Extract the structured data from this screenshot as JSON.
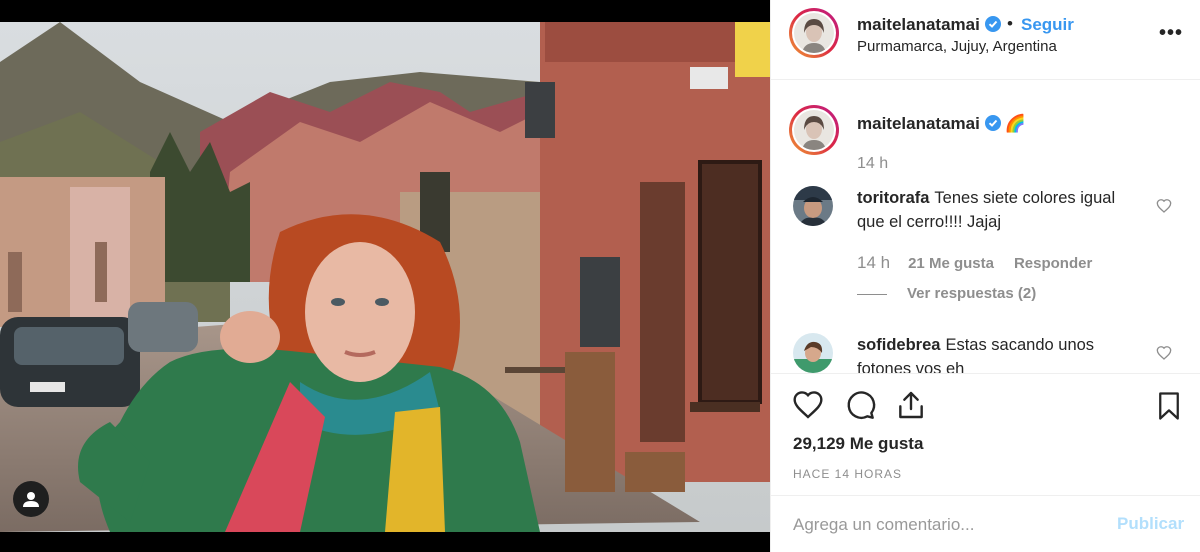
{
  "post": {
    "username": "maitelanatamai",
    "follow_separator": "•",
    "follow_label": "Seguir",
    "location": "Purmamarca, Jujuy, Argentina",
    "more_label": "•••",
    "caption_text": "🌈",
    "caption_time": "14 h"
  },
  "comments": [
    {
      "username": "toritorafa",
      "text": "Tenes siete colores igual que el cerro!!!! Jajaj",
      "time": "14 h",
      "likes": "21 Me gusta",
      "reply_label": "Responder",
      "view_replies": "Ver respuestas (2)"
    },
    {
      "username": "sofidebrea",
      "text": "Estas sacando unos fotones vos eh"
    }
  ],
  "stats": {
    "likes": "29,129 Me gusta",
    "time_ago": "HACE 14 HORAS"
  },
  "comment_box": {
    "placeholder": "Agrega un comentario...",
    "publish_label": "Publicar"
  },
  "colors": {
    "accent": "#3897f0",
    "publish_disabled": "#b2dffc",
    "muted": "#8e8e8e"
  },
  "icons": [
    "user-tag-icon",
    "verified-icon",
    "heart-icon",
    "comment-icon",
    "share-icon",
    "bookmark-icon",
    "more-icon"
  ]
}
